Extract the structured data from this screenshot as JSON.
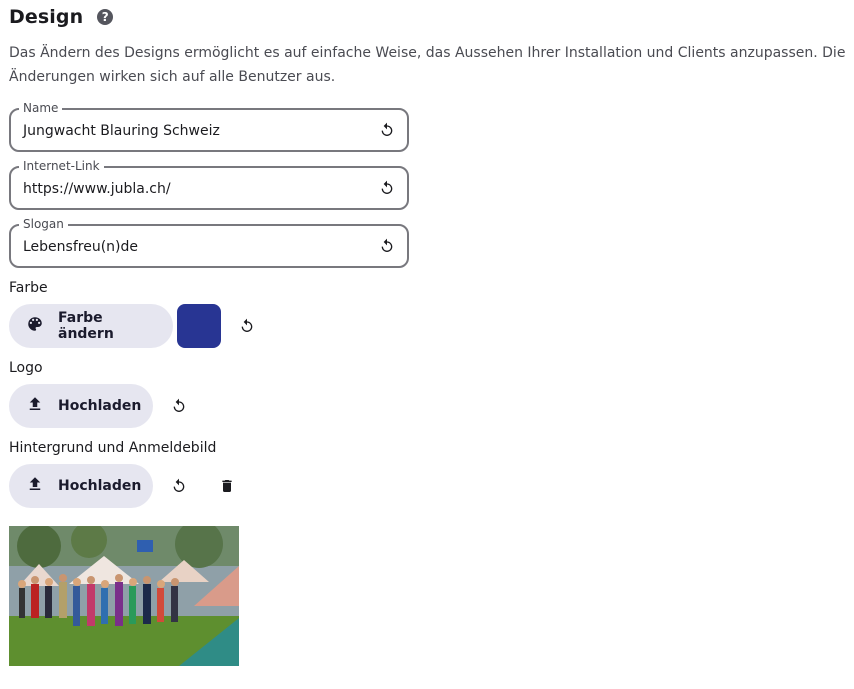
{
  "section": {
    "title": "Design",
    "help_icon": "help-circle-icon",
    "description": "Das Ändern des Designs ermöglicht es auf einfache Weise, das Aussehen Ihrer Installation und Clients anzupassen. Die Änderungen wirken sich auf alle Benutzer aus."
  },
  "fields": {
    "name": {
      "label": "Name",
      "value": "Jungwacht Blauring Schweiz"
    },
    "link": {
      "label": "Internet-Link",
      "value": "https://www.jubla.ch/"
    },
    "slogan": {
      "label": "Slogan",
      "value": "Lebensfreu(n)de"
    }
  },
  "color": {
    "label": "Farbe",
    "button_label": "Farbe ändern",
    "button_icon": "palette-icon",
    "swatch_color": "#283593"
  },
  "logo": {
    "label": "Logo",
    "button_label": "Hochladen",
    "button_icon": "upload-icon"
  },
  "background": {
    "label": "Hintergrund und Anmeldebild",
    "button_label": "Hochladen",
    "button_icon": "upload-icon"
  },
  "colors": {
    "field_border": "#78787e",
    "pill_bg": "#e6e6f0",
    "accent": "#283593"
  }
}
